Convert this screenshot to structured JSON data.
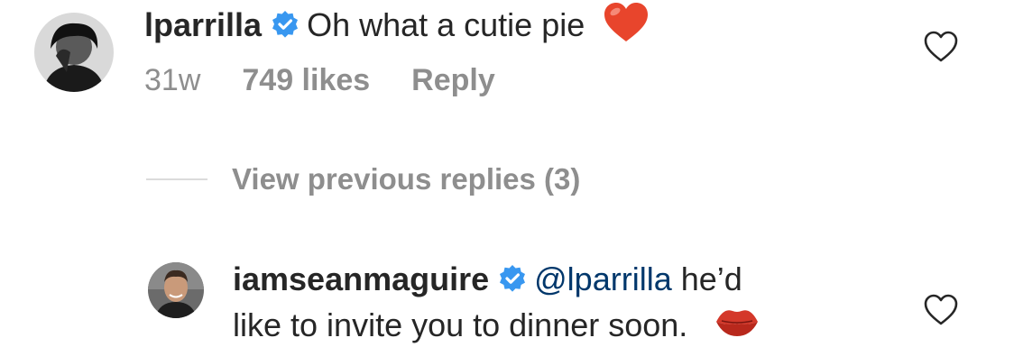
{
  "comments": [
    {
      "username": "lparrilla",
      "text": "Oh what a cutie pie",
      "emoji": "red-heart",
      "time": "31w",
      "likes": "749 likes",
      "reply_label": "Reply"
    }
  ],
  "thread": {
    "view_previous": "View previous replies (3)"
  },
  "replies": [
    {
      "username": "iamseanmaguire",
      "mention": "@lparrilla",
      "text_line1": "he’d",
      "text_line2": "like to invite you to dinner soon.",
      "emoji": "kiss-mark"
    }
  ],
  "colors": {
    "verified": "#3897f0",
    "muted": "#8e8e8e",
    "mention": "#00376b",
    "heart_emoji": "#e8452c",
    "lips_emoji": "#d4382a"
  }
}
